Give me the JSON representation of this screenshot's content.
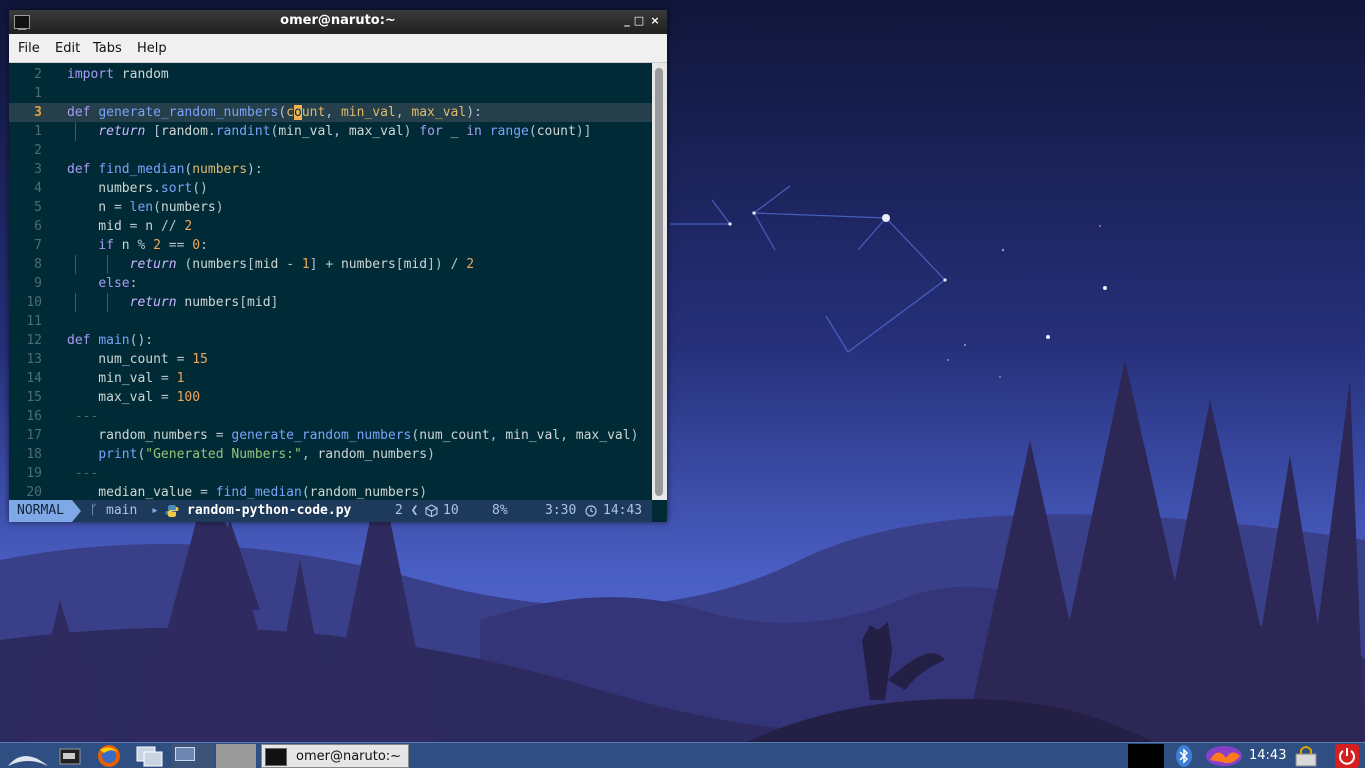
{
  "window": {
    "title": "omer@naruto:~",
    "controls": {
      "minimize": "_",
      "maximize": "□",
      "close": "×"
    }
  },
  "menubar": {
    "items": [
      "File",
      "Edit",
      "Tabs",
      "Help"
    ]
  },
  "editor": {
    "lines": [
      {
        "n": "2",
        "tokens": [
          [
            "kw",
            "import"
          ],
          [
            "t",
            " random"
          ]
        ]
      },
      {
        "n": "1",
        "tokens": []
      },
      {
        "n": "3",
        "current": true,
        "tokens": [
          [
            "kw",
            "def"
          ],
          [
            "t",
            " "
          ],
          [
            "fn",
            "generate_random_numbers"
          ],
          [
            "op",
            "("
          ],
          [
            "par",
            "c"
          ],
          [
            "cur",
            "o"
          ],
          [
            "par",
            "unt"
          ],
          [
            "op",
            ", "
          ],
          [
            "par",
            "min_val"
          ],
          [
            "op",
            ", "
          ],
          [
            "par",
            "max_val"
          ],
          [
            "op",
            "):"
          ]
        ]
      },
      {
        "n": "1",
        "guides": [
          1
        ],
        "tokens": [
          [
            "t",
            "    "
          ],
          [
            "ret",
            "return"
          ],
          [
            "op",
            " ["
          ],
          [
            "t",
            "random"
          ],
          [
            "op",
            "."
          ],
          [
            "fn",
            "randint"
          ],
          [
            "op",
            "("
          ],
          [
            "t",
            "min_val"
          ],
          [
            "op",
            ", "
          ],
          [
            "t",
            "max_val"
          ],
          [
            "op",
            ") "
          ],
          [
            "kw",
            "for"
          ],
          [
            "t",
            " _ "
          ],
          [
            "kw",
            "in"
          ],
          [
            "t",
            " "
          ],
          [
            "fn",
            "range"
          ],
          [
            "op",
            "("
          ],
          [
            "t",
            "count"
          ],
          [
            "op",
            ")]"
          ]
        ]
      },
      {
        "n": "2",
        "tokens": []
      },
      {
        "n": "3",
        "tokens": [
          [
            "kw",
            "def"
          ],
          [
            "t",
            " "
          ],
          [
            "fn",
            "find_median"
          ],
          [
            "op",
            "("
          ],
          [
            "par",
            "numbers"
          ],
          [
            "op",
            "):"
          ]
        ]
      },
      {
        "n": "4",
        "tokens": [
          [
            "t",
            "    numbers"
          ],
          [
            "op",
            "."
          ],
          [
            "fn",
            "sort"
          ],
          [
            "op",
            "()"
          ]
        ]
      },
      {
        "n": "5",
        "tokens": [
          [
            "t",
            "    n "
          ],
          [
            "op",
            "= "
          ],
          [
            "fn",
            "len"
          ],
          [
            "op",
            "("
          ],
          [
            "t",
            "numbers"
          ],
          [
            "op",
            ")"
          ]
        ]
      },
      {
        "n": "6",
        "tokens": [
          [
            "t",
            "    mid "
          ],
          [
            "op",
            "= "
          ],
          [
            "t",
            "n "
          ],
          [
            "op",
            "// "
          ],
          [
            "num",
            "2"
          ]
        ]
      },
      {
        "n": "7",
        "tokens": [
          [
            "t",
            "    "
          ],
          [
            "kw",
            "if"
          ],
          [
            "t",
            " n "
          ],
          [
            "op",
            "% "
          ],
          [
            "num",
            "2"
          ],
          [
            "op",
            " == "
          ],
          [
            "num",
            "0"
          ],
          [
            "op",
            ":"
          ]
        ]
      },
      {
        "n": "8",
        "guides": [
          2
        ],
        "tokens": [
          [
            "t",
            "        "
          ],
          [
            "ret",
            "return"
          ],
          [
            "op",
            " ("
          ],
          [
            "t",
            "numbers"
          ],
          [
            "op",
            "["
          ],
          [
            "t",
            "mid "
          ],
          [
            "op",
            "- "
          ],
          [
            "num",
            "1"
          ],
          [
            "op",
            "] + "
          ],
          [
            "t",
            "numbers"
          ],
          [
            "op",
            "["
          ],
          [
            "t",
            "mid"
          ],
          [
            "op",
            "]) / "
          ],
          [
            "num",
            "2"
          ]
        ]
      },
      {
        "n": "9",
        "tokens": [
          [
            "t",
            "    "
          ],
          [
            "kw",
            "else"
          ],
          [
            "op",
            ":"
          ]
        ]
      },
      {
        "n": "10",
        "guides": [
          2
        ],
        "tokens": [
          [
            "t",
            "        "
          ],
          [
            "ret",
            "return"
          ],
          [
            "t",
            " numbers"
          ],
          [
            "op",
            "["
          ],
          [
            "t",
            "mid"
          ],
          [
            "op",
            "]"
          ]
        ]
      },
      {
        "n": "11",
        "tokens": []
      },
      {
        "n": "12",
        "tokens": [
          [
            "kw",
            "def"
          ],
          [
            "t",
            " "
          ],
          [
            "fn",
            "main"
          ],
          [
            "op",
            "():"
          ]
        ]
      },
      {
        "n": "13",
        "tokens": [
          [
            "t",
            "    num_count "
          ],
          [
            "op",
            "= "
          ],
          [
            "num",
            "15"
          ]
        ]
      },
      {
        "n": "14",
        "tokens": [
          [
            "t",
            "    min_val "
          ],
          [
            "op",
            "= "
          ],
          [
            "num",
            "1"
          ]
        ]
      },
      {
        "n": "15",
        "tokens": [
          [
            "t",
            "    max_val "
          ],
          [
            "op",
            "= "
          ],
          [
            "num",
            "100"
          ]
        ]
      },
      {
        "n": "16",
        "tokens": [
          [
            "cmt",
            " ---"
          ]
        ]
      },
      {
        "n": "17",
        "tokens": [
          [
            "t",
            "    random_numbers "
          ],
          [
            "op",
            "= "
          ],
          [
            "fn",
            "generate_random_numbers"
          ],
          [
            "op",
            "("
          ],
          [
            "t",
            "num_count"
          ],
          [
            "op",
            ", "
          ],
          [
            "t",
            "min_val"
          ],
          [
            "op",
            ", "
          ],
          [
            "t",
            "max_val"
          ],
          [
            "op",
            ")"
          ]
        ]
      },
      {
        "n": "18",
        "tokens": [
          [
            "t",
            "    "
          ],
          [
            "fn",
            "print"
          ],
          [
            "op",
            "("
          ],
          [
            "str",
            "\"Generated Numbers:\""
          ],
          [
            "op",
            ", "
          ],
          [
            "t",
            "random_numbers"
          ],
          [
            "op",
            ")"
          ]
        ]
      },
      {
        "n": "19",
        "tokens": [
          [
            "cmt",
            " ---"
          ]
        ]
      },
      {
        "n": "20",
        "tokens": [
          [
            "t",
            "    median_value "
          ],
          [
            "op",
            "= "
          ],
          [
            "fn",
            "find_median"
          ],
          [
            "op",
            "("
          ],
          [
            "t",
            "random_numbers"
          ],
          [
            "op",
            ")"
          ]
        ]
      }
    ]
  },
  "statusline": {
    "mode": "NORMAL",
    "branch_icon": "git-branch-icon",
    "branch": "main",
    "file_icon": "python-icon",
    "filename": "random-python-code.py",
    "diagnostics": "2 ❮",
    "lsp_icon": "cube-icon",
    "lsp_count": "10",
    "percent": "8%",
    "position": "3:30",
    "clock_icon": "clock-icon",
    "time": "14:43"
  },
  "taskbar": {
    "task_label": "omer@naruto:~",
    "time": "14:43",
    "launchers": [
      "start-menu-icon",
      "file-manager-icon",
      "firefox-icon",
      "window-switcher-icon"
    ],
    "tray": [
      "bluetooth-icon",
      "volume-icon",
      "network-lock-icon",
      "power-icon"
    ]
  },
  "colors": {
    "terminal_bg": "#002b36",
    "mode_bg": "#7fa8e6",
    "statusline_bg": "#1e3a5a",
    "taskbar_bg": "#2f4f82"
  }
}
